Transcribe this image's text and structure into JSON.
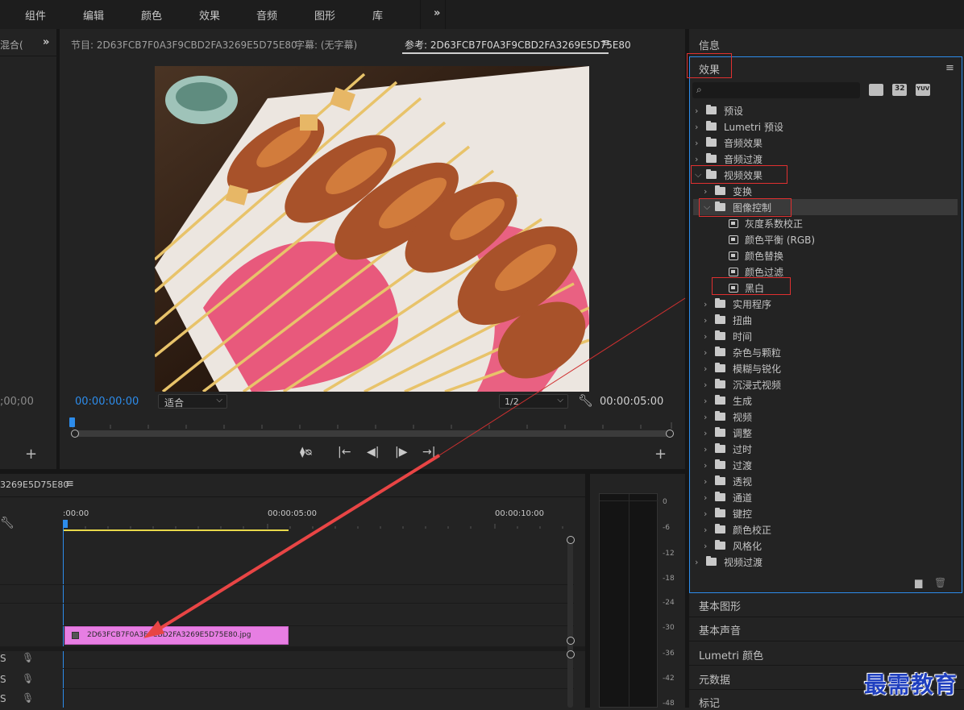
{
  "menu": {
    "items": [
      "组件",
      "编辑",
      "颜色",
      "效果",
      "音频",
      "图形",
      "库"
    ],
    "more_icon": "chevron-double-right-icon"
  },
  "left_panel": {
    "tab_label": "混合(",
    "timecode": ";00;00"
  },
  "program_monitor": {
    "tabs": [
      {
        "label": "节目: 2D63FCB7F0A3F9CBD2FA3269E5D75E80"
      },
      {
        "label": "字幕: (无字幕)"
      },
      {
        "label": "参考: 2D63FCB7F0A3F9CBD2FA3269E5D75E80"
      }
    ],
    "menu_icon": "hamburger-icon",
    "current_time": "00:00:00:00",
    "zoom_select": "适合",
    "resolution_select": "1/2",
    "duration": "00:00:05:00"
  },
  "timeline": {
    "sequence_label": "3269E5D75E80",
    "ruler": [
      ":00:00",
      "00:00:05:00",
      "00:00:10:00"
    ],
    "clip_name": "2D63FCB7F0A3F9CBD2FA3269E5D75E80.jpg",
    "track_labels": [
      "S",
      "S",
      "S"
    ]
  },
  "audio_meter": {
    "ticks": [
      "0",
      "-6",
      "-12",
      "-18",
      "-24",
      "-30",
      "-36",
      "-42",
      "-48"
    ]
  },
  "right_panel": {
    "info_label": "信息",
    "effects_label": "效果",
    "effects_menu_icon": "hamburger-icon",
    "search_placeholder": "",
    "filter_badges": [
      "accelerated-effects-icon",
      "32-bit-icon",
      "yuv-icon"
    ],
    "badge_text": [
      "",
      "32",
      "YUV"
    ],
    "tree": [
      {
        "label": "预设",
        "level": 0,
        "type": "star-folder",
        "expanded": false
      },
      {
        "label": "Lumetri 预设",
        "level": 0,
        "type": "star-folder",
        "expanded": false
      },
      {
        "label": "音频效果",
        "level": 0,
        "type": "folder",
        "expanded": false
      },
      {
        "label": "音频过渡",
        "level": 0,
        "type": "folder",
        "expanded": false
      },
      {
        "label": "视频效果",
        "level": 0,
        "type": "folder",
        "expanded": true
      },
      {
        "label": "变换",
        "level": 1,
        "type": "folder",
        "expanded": false
      },
      {
        "label": "图像控制",
        "level": 1,
        "type": "folder",
        "expanded": true
      },
      {
        "label": "灰度系数校正",
        "level": 2,
        "type": "effect"
      },
      {
        "label": "颜色平衡 (RGB)",
        "level": 2,
        "type": "effect"
      },
      {
        "label": "颜色替换",
        "level": 2,
        "type": "effect"
      },
      {
        "label": "颜色过滤",
        "level": 2,
        "type": "effect"
      },
      {
        "label": "黑白",
        "level": 2,
        "type": "effect"
      },
      {
        "label": "实用程序",
        "level": 1,
        "type": "folder",
        "expanded": false
      },
      {
        "label": "扭曲",
        "level": 1,
        "type": "folder",
        "expanded": false
      },
      {
        "label": "时间",
        "level": 1,
        "type": "folder",
        "expanded": false
      },
      {
        "label": "杂色与颗粒",
        "level": 1,
        "type": "folder",
        "expanded": false
      },
      {
        "label": "模糊与锐化",
        "level": 1,
        "type": "folder",
        "expanded": false
      },
      {
        "label": "沉浸式视频",
        "level": 1,
        "type": "folder",
        "expanded": false
      },
      {
        "label": "生成",
        "level": 1,
        "type": "folder",
        "expanded": false
      },
      {
        "label": "视频",
        "level": 1,
        "type": "folder",
        "expanded": false
      },
      {
        "label": "调整",
        "level": 1,
        "type": "folder",
        "expanded": false
      },
      {
        "label": "过时",
        "level": 1,
        "type": "folder",
        "expanded": false
      },
      {
        "label": "过渡",
        "level": 1,
        "type": "folder",
        "expanded": false
      },
      {
        "label": "透视",
        "level": 1,
        "type": "folder",
        "expanded": false
      },
      {
        "label": "通道",
        "level": 1,
        "type": "folder",
        "expanded": false
      },
      {
        "label": "键控",
        "level": 1,
        "type": "folder",
        "expanded": false
      },
      {
        "label": "颜色校正",
        "level": 1,
        "type": "folder",
        "expanded": false
      },
      {
        "label": "风格化",
        "level": 1,
        "type": "folder",
        "expanded": false
      },
      {
        "label": "视频过渡",
        "level": 0,
        "type": "folder",
        "expanded": false
      }
    ],
    "bottom_panels": [
      "基本图形",
      "基本声音",
      "Lumetri 颜色",
      "元数据",
      "标记"
    ]
  },
  "watermark": "最需教育",
  "colors": {
    "accent_blue": "#2d8ceb",
    "clip_pink": "#e77ee3",
    "highlight_red": "#e03030",
    "playhead_yellow": "#e8d84a"
  }
}
